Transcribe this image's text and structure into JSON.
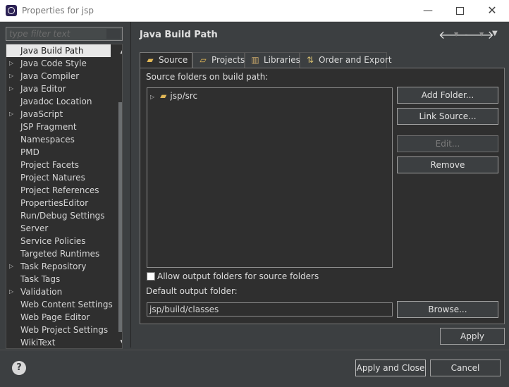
{
  "window": {
    "title": "Properties for jsp",
    "minimize": "—",
    "close": "✕"
  },
  "filter": {
    "placeholder": "type filter text"
  },
  "tree": {
    "items": [
      {
        "label": "Java Build Path",
        "expandable": false,
        "selected": true
      },
      {
        "label": "Java Code Style",
        "expandable": true
      },
      {
        "label": "Java Compiler",
        "expandable": true
      },
      {
        "label": "Java Editor",
        "expandable": true
      },
      {
        "label": "Javadoc Location",
        "expandable": false
      },
      {
        "label": "JavaScript",
        "expandable": true
      },
      {
        "label": "JSP Fragment",
        "expandable": false
      },
      {
        "label": "Namespaces",
        "expandable": false
      },
      {
        "label": "PMD",
        "expandable": false
      },
      {
        "label": "Project Facets",
        "expandable": false
      },
      {
        "label": "Project Natures",
        "expandable": false
      },
      {
        "label": "Project References",
        "expandable": false
      },
      {
        "label": "PropertiesEditor",
        "expandable": false
      },
      {
        "label": "Run/Debug Settings",
        "expandable": false
      },
      {
        "label": "Server",
        "expandable": false
      },
      {
        "label": "Service Policies",
        "expandable": false
      },
      {
        "label": "Targeted Runtimes",
        "expandable": false
      },
      {
        "label": "Task Repository",
        "expandable": true
      },
      {
        "label": "Task Tags",
        "expandable": false
      },
      {
        "label": "Validation",
        "expandable": true
      },
      {
        "label": "Web Content Settings",
        "expandable": false
      },
      {
        "label": "Web Page Editor",
        "expandable": false
      },
      {
        "label": "Web Project Settings",
        "expandable": false
      },
      {
        "label": "WikiText",
        "expandable": false
      }
    ]
  },
  "page": {
    "title": "Java Build Path"
  },
  "tabs": [
    {
      "label": "Source",
      "icon": "source-folder-icon",
      "active": true
    },
    {
      "label": "Projects",
      "icon": "projects-icon"
    },
    {
      "label": "Libraries",
      "icon": "libraries-icon"
    },
    {
      "label": "Order and Export",
      "icon": "order-export-icon"
    }
  ],
  "source": {
    "list_label": "Source folders on build path:",
    "folders": [
      "jsp/src"
    ],
    "buttons": {
      "add_folder": "Add Folder...",
      "link_source": "Link Source...",
      "edit": "Edit...",
      "remove": "Remove"
    },
    "allow_output_label": "Allow output folders for source folders",
    "allow_output_checked": false,
    "default_output_label": "Default output folder:",
    "default_output_value": "jsp/build/classes",
    "browse": "Browse..."
  },
  "footer": {
    "apply": "Apply",
    "apply_and_close": "Apply and Close",
    "cancel": "Cancel",
    "help": "?"
  }
}
